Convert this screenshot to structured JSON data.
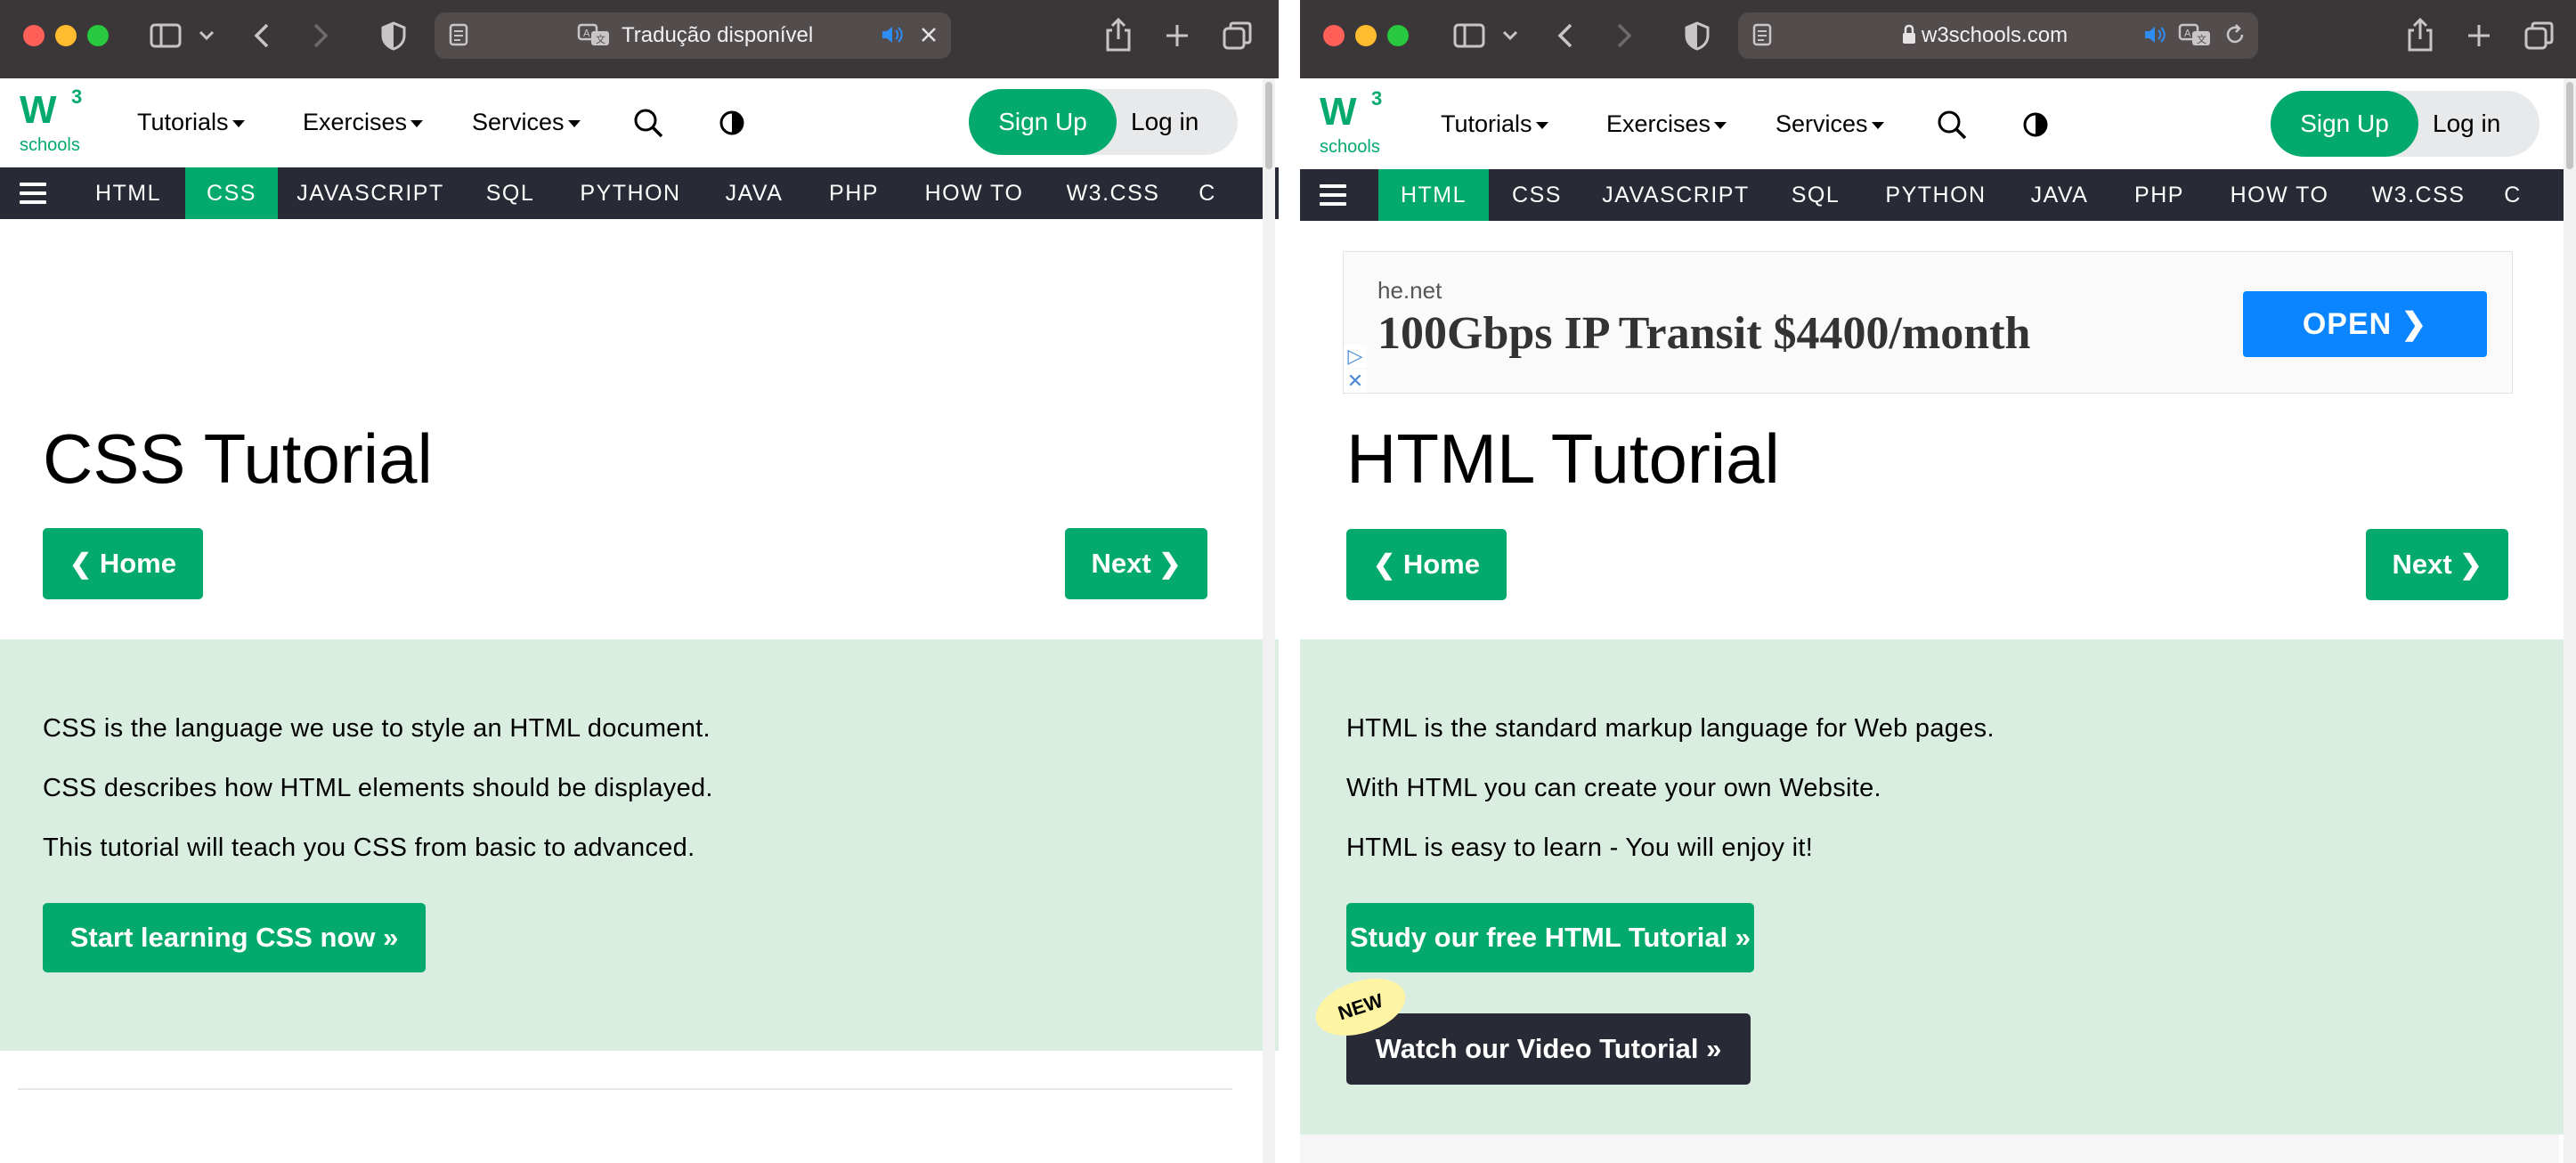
{
  "colors": {
    "toolbar_bg": "#3b3637",
    "brand_green": "#04aa6d",
    "nav_dark": "#282a35",
    "panel_green": "#d9eee1",
    "new_badge": "#fff4a3",
    "ad_button": "#0a84ff"
  },
  "left": {
    "toolbar": {
      "url_text": "Tradução disponível",
      "icons": [
        "sidebar-icon",
        "chevron-down-icon",
        "back-icon",
        "forward-icon",
        "shield-icon",
        "reader-icon",
        "translate-icon",
        "speaker-icon",
        "close-icon",
        "share-icon",
        "plus-icon",
        "tabs-icon"
      ]
    },
    "header": {
      "logo_w3": "W",
      "logo_sup": "3",
      "logo_schools": "schools",
      "tutorials": "Tutorials",
      "exercises": "Exercises",
      "services": "Services",
      "signup": "Sign Up",
      "login": "Log in"
    },
    "topnav": {
      "items": [
        "HTML",
        "CSS",
        "JAVASCRIPT",
        "SQL",
        "PYTHON",
        "JAVA",
        "PHP",
        "HOW TO",
        "W3.CSS",
        "C"
      ],
      "active": "CSS"
    },
    "main": {
      "title": "CSS Tutorial",
      "home_button": "Home",
      "next_button": "Next",
      "paragraphs": [
        "CSS is the language we use to style an HTML document.",
        "CSS describes how HTML elements should be displayed.",
        "This tutorial will teach you CSS from basic to advanced."
      ],
      "cta_button": "Start learning CSS now »"
    }
  },
  "right": {
    "toolbar": {
      "url_text": "w3schools.com",
      "icons": [
        "sidebar-icon",
        "chevron-down-icon",
        "back-icon",
        "forward-icon",
        "shield-icon",
        "reader-icon",
        "lock-icon",
        "speaker-icon",
        "translate-icon",
        "reload-icon",
        "share-icon",
        "plus-icon",
        "tabs-icon"
      ]
    },
    "header": {
      "logo_w3": "W",
      "logo_sup": "3",
      "logo_schools": "schools",
      "tutorials": "Tutorials",
      "exercises": "Exercises",
      "services": "Services",
      "signup": "Sign Up",
      "login": "Log in"
    },
    "topnav": {
      "items": [
        "HTML",
        "CSS",
        "JAVASCRIPT",
        "SQL",
        "PYTHON",
        "JAVA",
        "PHP",
        "HOW TO",
        "W3.CSS",
        "C"
      ],
      "active": "HTML"
    },
    "ad": {
      "domain": "he.net",
      "title": "100Gbps IP Transit $4400/month",
      "button": "OPEN"
    },
    "main": {
      "title": "HTML Tutorial",
      "home_button": "Home",
      "next_button": "Next",
      "paragraphs": [
        "HTML is the standard markup language for Web pages.",
        "With HTML you can create your own Website.",
        "HTML is easy to learn - You will enjoy it!"
      ],
      "cta_button": "Study our free HTML Tutorial »",
      "new_badge": "NEW",
      "video_button": "Watch our Video Tutorial »"
    }
  }
}
